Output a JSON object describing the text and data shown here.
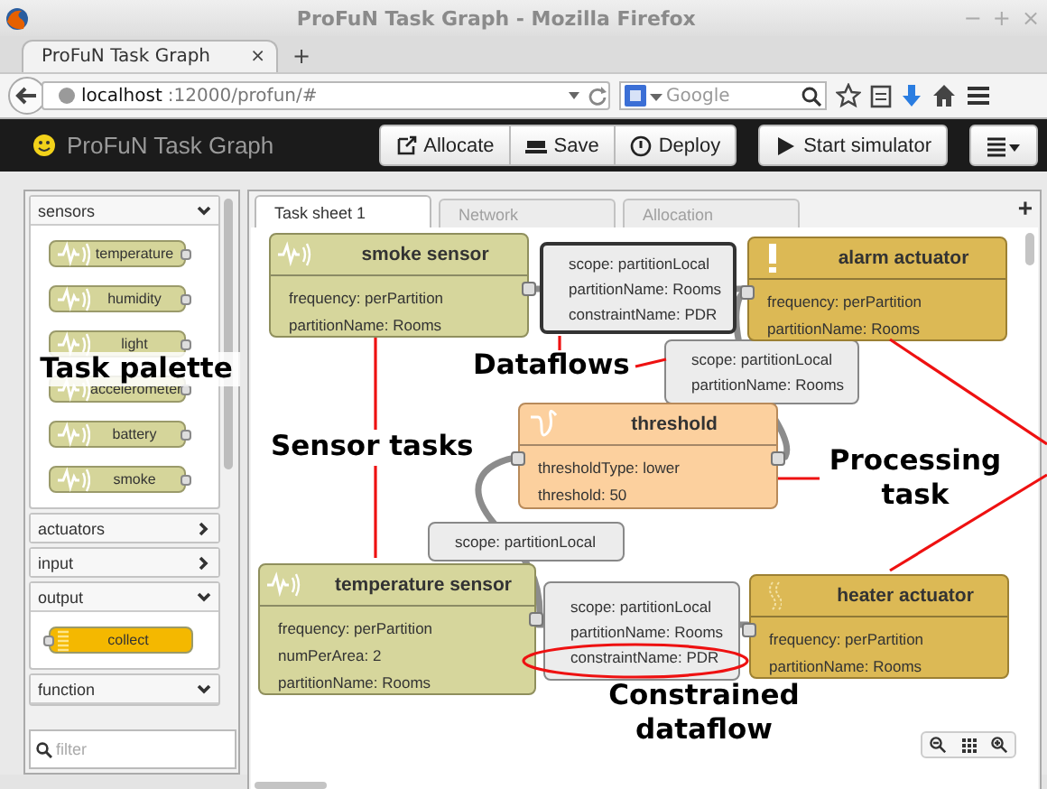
{
  "window": {
    "title": "ProFuN Task Graph - Mozilla Firefox",
    "controls": [
      "−",
      "+",
      "×"
    ]
  },
  "browser_tabs": [
    {
      "label": "ProFuN Task Graph",
      "selected": true,
      "close": "×"
    }
  ],
  "new_tab_button": "+",
  "address_bar": {
    "host": "localhost",
    "path": ":12000/profun/#"
  },
  "search": {
    "placeholder": "Google"
  },
  "app": {
    "title": "ProFuN Task Graph",
    "buttons": [
      {
        "kind": "allocate",
        "label": "Allocate"
      },
      {
        "kind": "save",
        "label": "Save"
      },
      {
        "kind": "deploy",
        "label": "Deploy"
      },
      {
        "kind": "start",
        "label": "Start simulator"
      },
      {
        "kind": "menu"
      }
    ]
  },
  "palette": {
    "categories": [
      {
        "name": "sensors",
        "expanded": true,
        "items": [
          {
            "kind": "sensor",
            "label": "temperature"
          },
          {
            "kind": "sensor",
            "label": "humidity"
          },
          {
            "kind": "sensor",
            "label": "light"
          },
          {
            "kind": "sensor",
            "label": "accelerometer"
          },
          {
            "kind": "sensor",
            "label": "battery"
          },
          {
            "kind": "sensor",
            "label": "smoke"
          }
        ]
      },
      {
        "name": "actuators",
        "expanded": false
      },
      {
        "name": "input",
        "expanded": false
      },
      {
        "name": "output",
        "expanded": true,
        "items": [
          {
            "kind": "output",
            "label": "collect"
          }
        ]
      },
      {
        "name": "function",
        "expanded": true
      }
    ],
    "filter": {
      "placeholder": "filter"
    }
  },
  "sheet_tabs": [
    {
      "label": "Task sheet 1",
      "selected": true
    },
    {
      "label": "Network",
      "selected": false
    },
    {
      "label": "Allocation",
      "selected": false
    }
  ],
  "add_sheet_button": "+",
  "tasks": [
    {
      "kind": "sensor",
      "title": "smoke sensor",
      "properties": [
        "frequency: perPartition",
        "partitionName: Rooms"
      ]
    },
    {
      "kind": "alarm",
      "title": "alarm actuator",
      "properties": [
        "frequency: perPartition",
        "partitionName: Rooms"
      ]
    },
    {
      "kind": "process",
      "title": "threshold",
      "properties": [
        "thresholdType: lower",
        "threshold: 50"
      ]
    },
    {
      "kind": "sensor",
      "title": "temperature sensor",
      "properties": [
        "frequency: perPartition",
        "numPerArea: 2",
        "partitionName: Rooms"
      ]
    },
    {
      "kind": "heater",
      "title": "heater actuator",
      "properties": [
        "frequency: perPartition",
        "partitionName: Rooms"
      ]
    }
  ],
  "dataflows": [
    {
      "selected": true,
      "properties": [
        "scope: partitionLocal",
        "partitionName: Rooms",
        "constraintName: PDR"
      ]
    },
    {
      "selected": false,
      "properties": [
        "scope: partitionLocal",
        "partitionName: Rooms"
      ]
    },
    {
      "selected": false,
      "properties": [
        "scope: partitionLocal"
      ]
    },
    {
      "selected": false,
      "properties": [
        "scope: partitionLocal",
        "partitionName: Rooms",
        "constraintName: PDR"
      ]
    }
  ],
  "annotations": [
    "Task palette",
    "Dataflows",
    "Sensor tasks",
    "Processing task",
    "Constrained dataflow"
  ]
}
